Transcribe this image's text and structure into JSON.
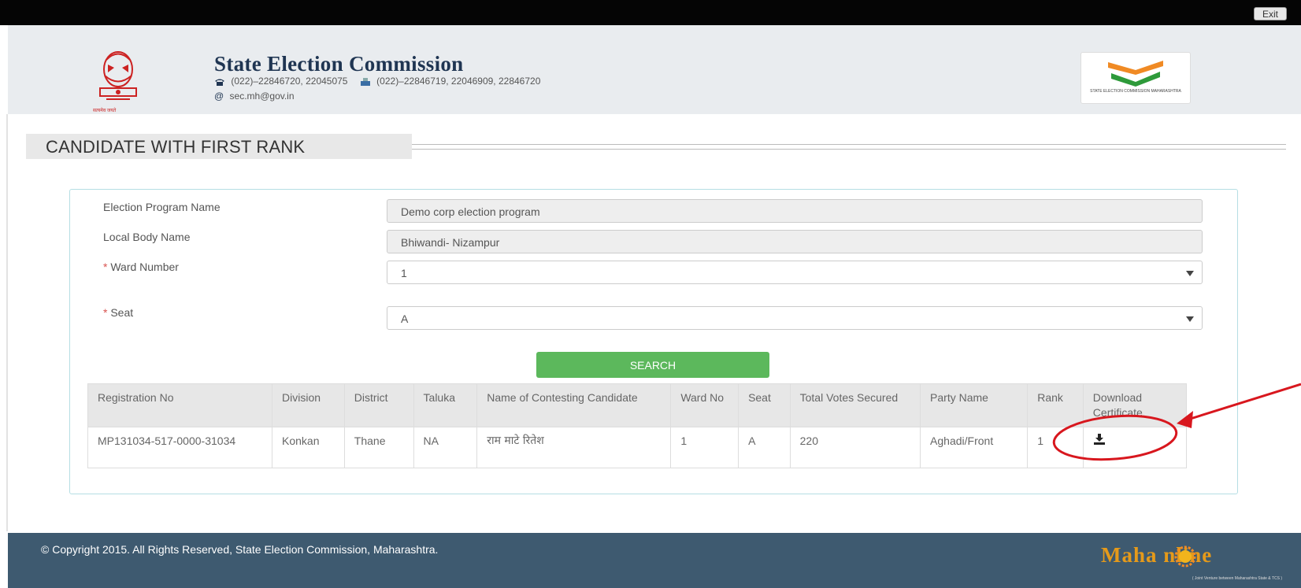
{
  "topbar": {
    "exit_label": "Exit"
  },
  "header": {
    "title": "State Election Commission",
    "phone": "(022)–22846720, 22045075",
    "fax": "(022)–22846719, 22046909, 22846720",
    "email": "sec.mh@gov.in",
    "emblem_caption": "सत्यमेव जयते",
    "logo_caption": "STATE ELECTION COMMISSION MAHARASHTRA"
  },
  "section": {
    "title": "CANDIDATE WITH FIRST RANK"
  },
  "form": {
    "program_label": "Election Program Name",
    "program_value": "Demo corp election program",
    "localbody_label": "Local Body Name",
    "localbody_value": "Bhiwandi- Nizampur",
    "required_mark": "*",
    "ward_label": "Ward Number",
    "ward_value": "1",
    "seat_label": "Seat",
    "seat_value": "A",
    "search_label": "SEARCH"
  },
  "table": {
    "headers": [
      "Registration No",
      "Division",
      "District",
      "Taluka",
      "Name of Contesting Candidate",
      "Ward No",
      "Seat",
      "Total Votes Secured",
      "Party Name",
      "Rank",
      "Download Certificate"
    ],
    "rows": [
      {
        "registration_no": "MP131034-517-0000-31034",
        "division": "Konkan",
        "district": "Thane",
        "taluka": "NA",
        "candidate": "राम माटे रितेश",
        "ward_no": "1",
        "seat": "A",
        "total_votes": "220",
        "party": "Aghadi/Front",
        "rank": "1"
      }
    ]
  },
  "footer": {
    "copyright": "© Copyright 2015. All Rights Reserved, State Election Commission, Maharashtra.",
    "brand": "Maha  nline",
    "brand_sub": "( Joint Venture between Maharashtra State & TCS )"
  },
  "colors": {
    "topbar": "#050505",
    "header_bg": "#e9ecef",
    "title": "#1f3552",
    "search_button": "#5cb85c",
    "footer_bg": "#3e5a70",
    "annotation": "#d8171e"
  }
}
